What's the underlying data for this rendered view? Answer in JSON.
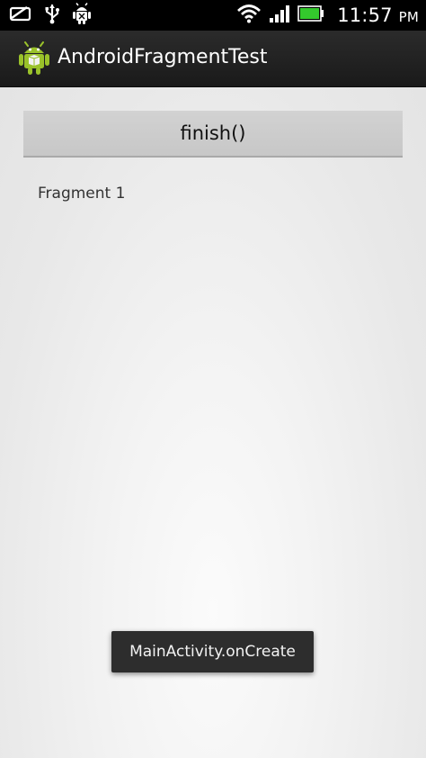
{
  "status_bar": {
    "time": "11:57",
    "ampm": "PM",
    "icons": [
      "notification-card-icon",
      "usb-icon",
      "android-debug-icon",
      "wifi-icon",
      "signal-icon",
      "battery-icon"
    ],
    "battery_color": "#34c92d"
  },
  "action_bar": {
    "title": "AndroidFragmentTest",
    "icon": "android-app-icon",
    "icon_color": "#9ac22a"
  },
  "main": {
    "finish_button_label": "finish()",
    "fragment_label": "Fragment 1"
  },
  "toast": {
    "message": "MainActivity.onCreate"
  }
}
